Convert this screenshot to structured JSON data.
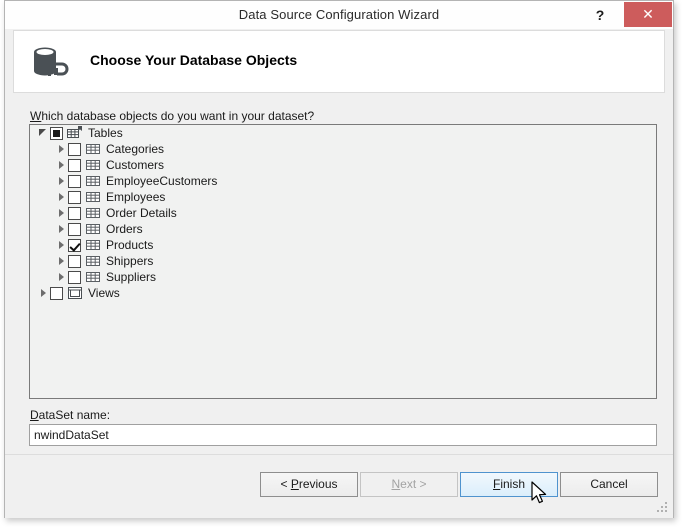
{
  "window": {
    "title": "Data Source Configuration Wizard",
    "help_label": "?",
    "close_label": "✕"
  },
  "header": {
    "title": "Choose Your Database Objects",
    "icon": "database-icon"
  },
  "main": {
    "prompt": "Which database objects do you want in your dataset?",
    "prompt_accel": "W",
    "prompt_rest": "hich database objects do you want in your dataset?",
    "tree": [
      {
        "label": "Tables",
        "level": 0,
        "expander": "expanded",
        "check": "partial",
        "icon": "tables-group-icon"
      },
      {
        "label": "Categories",
        "level": 1,
        "expander": "collapsed",
        "check": "unchecked",
        "icon": "table-icon"
      },
      {
        "label": "Customers",
        "level": 1,
        "expander": "collapsed",
        "check": "unchecked",
        "icon": "table-icon"
      },
      {
        "label": "EmployeeCustomers",
        "level": 1,
        "expander": "collapsed",
        "check": "unchecked",
        "icon": "table-icon"
      },
      {
        "label": "Employees",
        "level": 1,
        "expander": "collapsed",
        "check": "unchecked",
        "icon": "table-icon"
      },
      {
        "label": "Order Details",
        "level": 1,
        "expander": "collapsed",
        "check": "unchecked",
        "icon": "table-icon"
      },
      {
        "label": "Orders",
        "level": 1,
        "expander": "collapsed",
        "check": "unchecked",
        "icon": "table-icon"
      },
      {
        "label": "Products",
        "level": 1,
        "expander": "collapsed",
        "check": "checked",
        "icon": "table-icon"
      },
      {
        "label": "Shippers",
        "level": 1,
        "expander": "collapsed",
        "check": "unchecked",
        "icon": "table-icon"
      },
      {
        "label": "Suppliers",
        "level": 1,
        "expander": "collapsed",
        "check": "unchecked",
        "icon": "table-icon"
      },
      {
        "label": "Views",
        "level": 0,
        "expander": "collapsed",
        "check": "unchecked",
        "icon": "view-icon"
      }
    ],
    "dataset": {
      "label": "DataSet name:",
      "label_accel": "D",
      "label_rest": "ataSet name:",
      "value": "nwindDataSet",
      "placeholder": ""
    }
  },
  "footer": {
    "buttons": [
      {
        "id": "btn-prev",
        "label": "< Previous",
        "accel": "P",
        "state": "enabled"
      },
      {
        "id": "btn-next",
        "label": "Next >",
        "accel": "N",
        "state": "disabled"
      },
      {
        "id": "btn-finish",
        "label": "Finish",
        "accel": "F",
        "state": "default"
      },
      {
        "id": "btn-cancel",
        "label": "Cancel",
        "accel": "",
        "state": "enabled"
      }
    ]
  },
  "colors": {
    "close_button": "#cd5c5c",
    "default_button_border": "#4f93ce",
    "dialog_background": "#f0f0f0",
    "tree_background": "#f1f2f1",
    "icon_dark": "#4a5055"
  }
}
